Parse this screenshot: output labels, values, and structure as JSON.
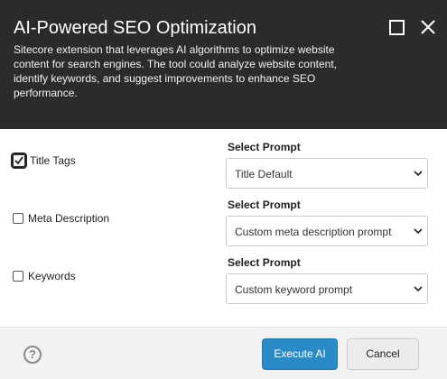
{
  "dialog": {
    "title": "AI-Powered SEO Optimization",
    "description": "Sitecore extension that leverages AI algorithms to optimize website content for search engines. The tool could analyze website content, identify keywords, and suggest improvements to enhance SEO performance."
  },
  "fields": [
    {
      "label": "Title Tags",
      "checked": true,
      "prompt_label": "Select Prompt",
      "prompt_value": "Title Default"
    },
    {
      "label": "Meta Description",
      "checked": false,
      "prompt_label": "Select Prompt",
      "prompt_value": "Custom meta description prompt"
    },
    {
      "label": "Keywords",
      "checked": false,
      "prompt_label": "Select Prompt",
      "prompt_value": "Custom keyword prompt"
    }
  ],
  "footer": {
    "help_glyph": "?",
    "execute_label": "Execute AI",
    "cancel_label": "Cancel"
  },
  "icons": {
    "maximize": "maximize-icon",
    "close": "close-icon",
    "help": "help-icon",
    "chevron": "chevron-down-icon",
    "check": "checkmark-icon"
  },
  "colors": {
    "header_bg": "#2b2b2b",
    "primary_button": "#2a8bc6",
    "footer_bg": "#f2f2f2"
  }
}
